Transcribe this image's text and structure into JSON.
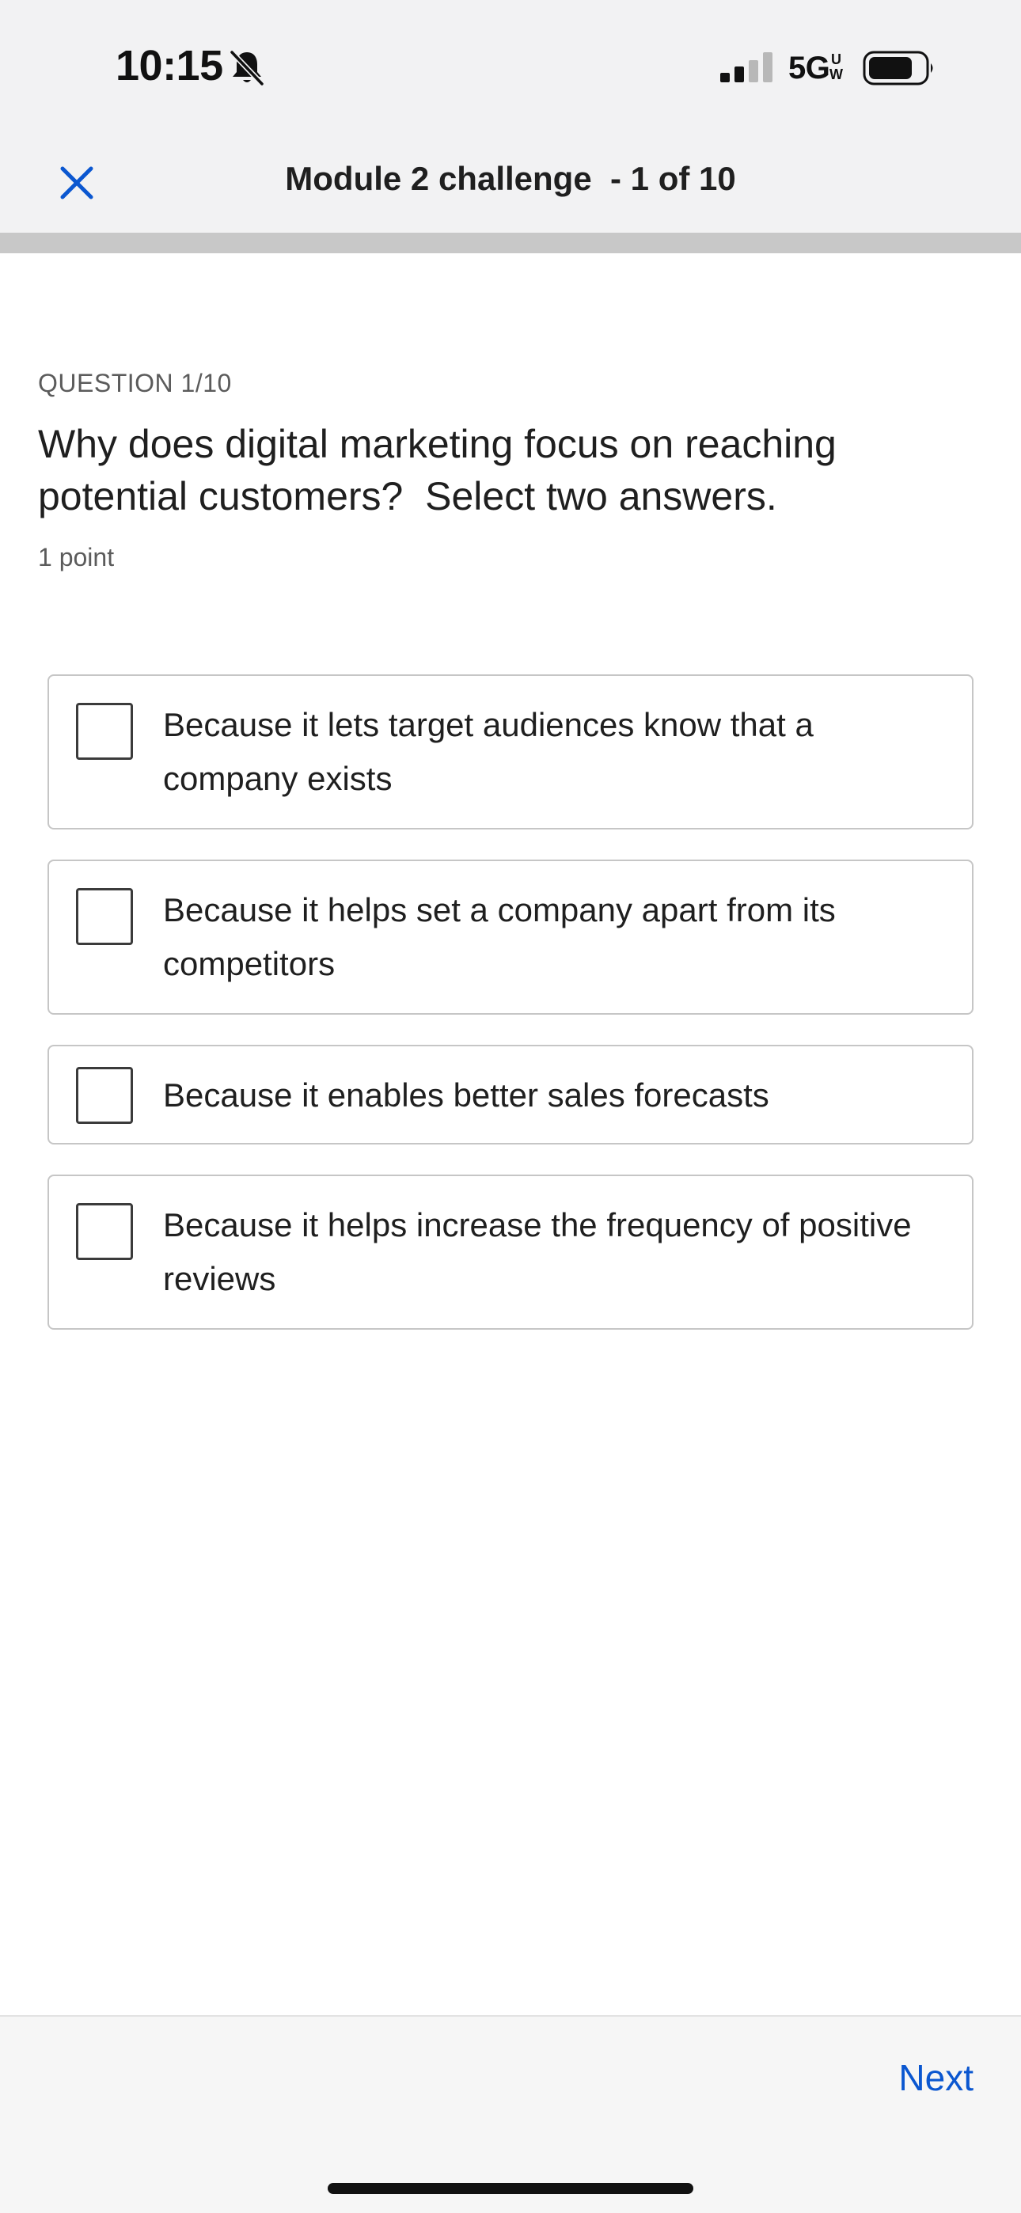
{
  "status_bar": {
    "time": "10:15",
    "network": "5G",
    "network_superscript_top": "U",
    "network_superscript_bottom": "W",
    "icons": [
      "bell-off-icon",
      "signal-icon",
      "battery-icon"
    ]
  },
  "header": {
    "close_icon": "close-icon",
    "title": "Module 2 challenge  - 1 of 10"
  },
  "progress": {
    "fraction": 0
  },
  "question": {
    "label": "QUESTION 1/10",
    "text": "Why does digital marketing focus on reaching potential customers?  Select two answers.",
    "points": "1 point"
  },
  "options": [
    {
      "text": "Because it lets target audiences know that a company exists",
      "checked": false
    },
    {
      "text": "Because it helps set a company apart from its competitors",
      "checked": false
    },
    {
      "text": "Because it enables better sales forecasts",
      "checked": false
    },
    {
      "text": "Because it helps increase the frequency of positive reviews",
      "checked": false
    }
  ],
  "footer": {
    "next_label": "Next"
  },
  "colors": {
    "accent": "#0b57d0",
    "header_bg": "#f2f2f3",
    "option_border": "#c6c6c6"
  }
}
